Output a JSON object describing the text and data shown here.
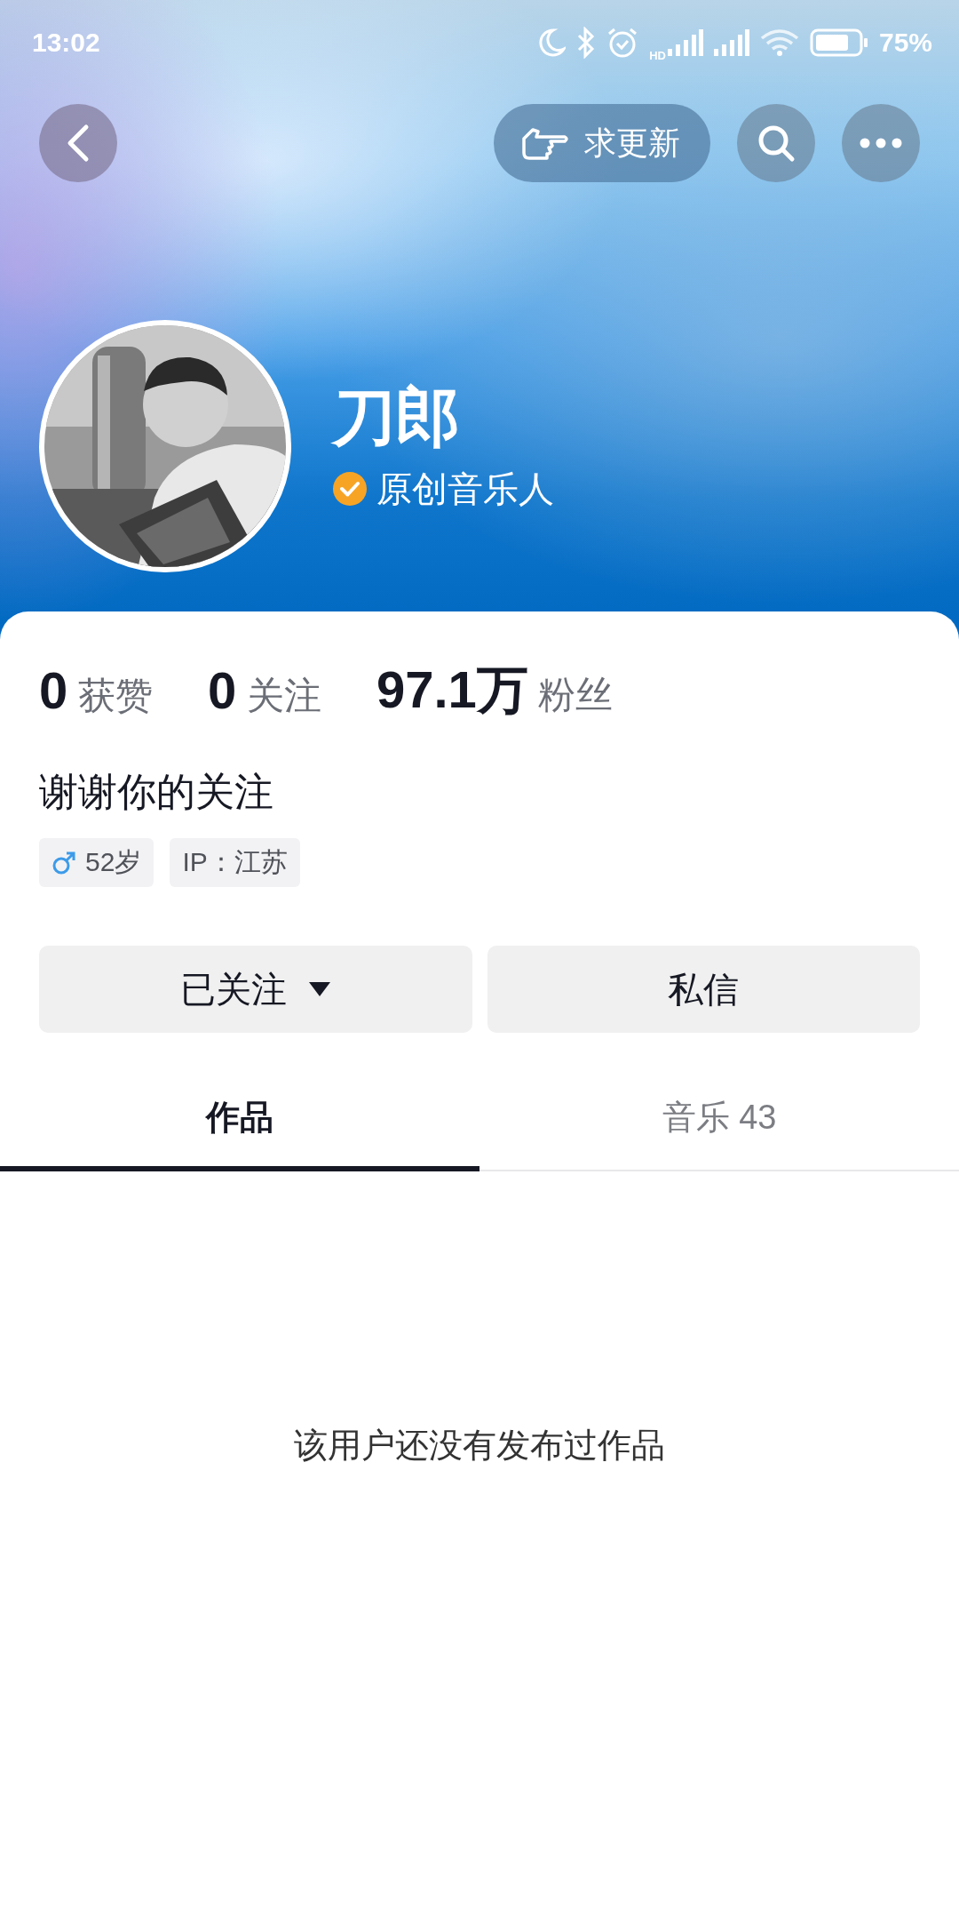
{
  "status_bar": {
    "time": "13:02",
    "hd_label": "HD",
    "battery": "75%"
  },
  "top_bar": {
    "request_update_button": "求更新"
  },
  "profile": {
    "name": "刀郎",
    "verified": true,
    "verified_label": "原创音乐人"
  },
  "stats": [
    "**0** 获赞",
    "**0** 关注",
    "**97.1万** 粉丝"
  ],
  "bio": "谢谢你的关注",
  "tags": [
    {
      "kind": "male",
      "text": "52岁"
    },
    {
      "kind": "text",
      "text": "IP：江苏"
    }
  ],
  "actions": [
    {
      "label": "已关注",
      "dropdown": true
    },
    {
      "label": "私信",
      "dropdown": false
    }
  ],
  "tabs": [
    {
      "label": "作品",
      "selected": true
    },
    {
      "label": "音乐 43",
      "selected": false
    }
  ],
  "empty_message": "该用户还没有发布过作品"
}
